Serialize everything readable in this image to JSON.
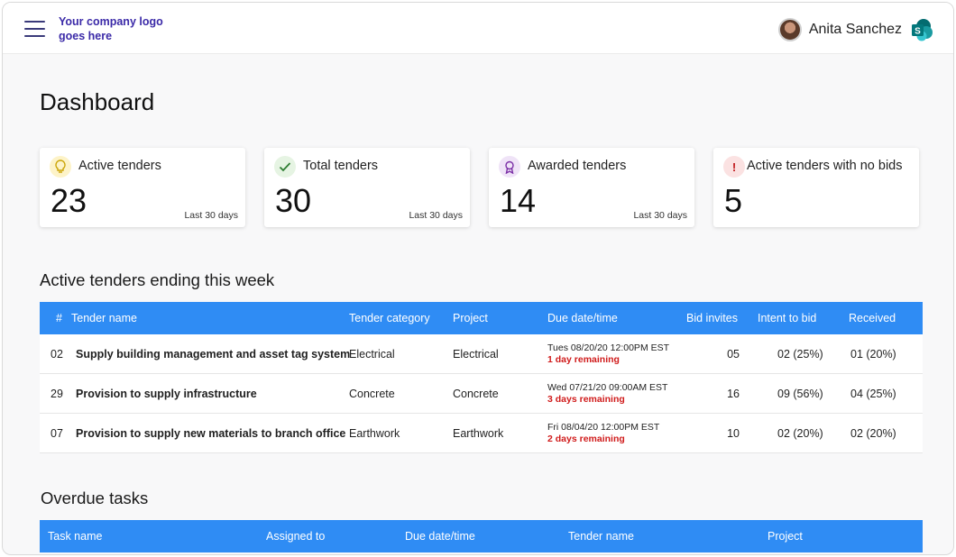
{
  "header": {
    "logo_text": "Your company logo goes here",
    "user_name": "Anita Sanchez"
  },
  "page_title": "Dashboard",
  "kpis": [
    {
      "label": "Active tenders",
      "value": "23",
      "period": "Last 30 days",
      "icon": "lightbulb-icon"
    },
    {
      "label": "Total tenders",
      "value": "30",
      "period": "Last 30 days",
      "icon": "checkmark-icon"
    },
    {
      "label": "Awarded tenders",
      "value": "14",
      "period": "Last 30 days",
      "icon": "award-ribbon-icon"
    },
    {
      "label": "Active tenders with no bids",
      "value": "5",
      "period": "",
      "icon": "exclamation-icon"
    }
  ],
  "active_tenders": {
    "title": "Active tenders ending this week",
    "columns": [
      "#",
      "Tender name",
      "Tender category",
      "Project",
      "Due date/time",
      "Bid invites",
      "Intent to bid",
      "Received"
    ],
    "rows": [
      {
        "num": "02",
        "name": "Supply building management and asset tag system",
        "category": "Electrical",
        "project": "Electrical",
        "due": "Tues 08/20/20 12:00PM EST",
        "remaining": "1 day remaining",
        "invites": "05",
        "intent": "02 (25%)",
        "received": "01 (20%)"
      },
      {
        "num": "29",
        "name": "Provision to supply infrastructure",
        "category": "Concrete",
        "project": "Concrete",
        "due": "Wed 07/21/20 09:00AM EST",
        "remaining": "3 days remaining",
        "invites": "16",
        "intent": "09 (56%)",
        "received": "04 (25%)"
      },
      {
        "num": "07",
        "name": "Provision to supply new materials to branch office",
        "category": "Earthwork",
        "project": "Earthwork",
        "due": "Fri 08/04/20 12:00PM EST",
        "remaining": "2 days remaining",
        "invites": "10",
        "intent": "02 (20%)",
        "received": "02 (20%)"
      }
    ]
  },
  "overdue_tasks": {
    "title": "Overdue tasks",
    "columns": [
      "Task name",
      "Assigned to",
      "Due date/time",
      "Tender name",
      "Project"
    ]
  },
  "colors": {
    "accent": "#2f8cf4",
    "logo": "#3b2aa8",
    "danger": "#d01b1b"
  }
}
